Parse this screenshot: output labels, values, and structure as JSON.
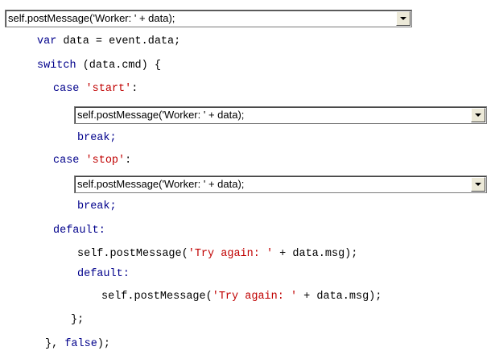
{
  "dropdowns": {
    "first": {
      "selected": "self.postMessage('Worker: ' + data);"
    },
    "start": {
      "selected": "self.postMessage('Worker: ' + data);"
    },
    "stop": {
      "selected": "self.postMessage('Worker: ' + data);"
    }
  },
  "code": {
    "line_var": {
      "kw": "var",
      "rest": " data = event.data;"
    },
    "line_switch": {
      "kw": "switch",
      "rest": " (data.cmd) {"
    },
    "case_start": {
      "kw": "case",
      "sp": " ",
      "str": "'start'",
      "rest": ":"
    },
    "break_1": "break;",
    "case_stop": {
      "kw": "case",
      "sp": " ",
      "str": "'stop'",
      "rest": ":"
    },
    "break_2": "break;",
    "default_1": "default:",
    "post_1": {
      "pre": "self.postMessage(",
      "str": "'Try again: '",
      "rest": " + data.msg);"
    },
    "default_2": "default:",
    "post_2": {
      "pre": "self.postMessage(",
      "str": "'Try again: '",
      "rest": " + data.msg);"
    },
    "close_1": "};",
    "close_2": {
      "pre": "}, ",
      "kw": "false",
      "rest": ");"
    }
  },
  "icons": {
    "dropdown_arrow": "chevron-down-icon"
  }
}
